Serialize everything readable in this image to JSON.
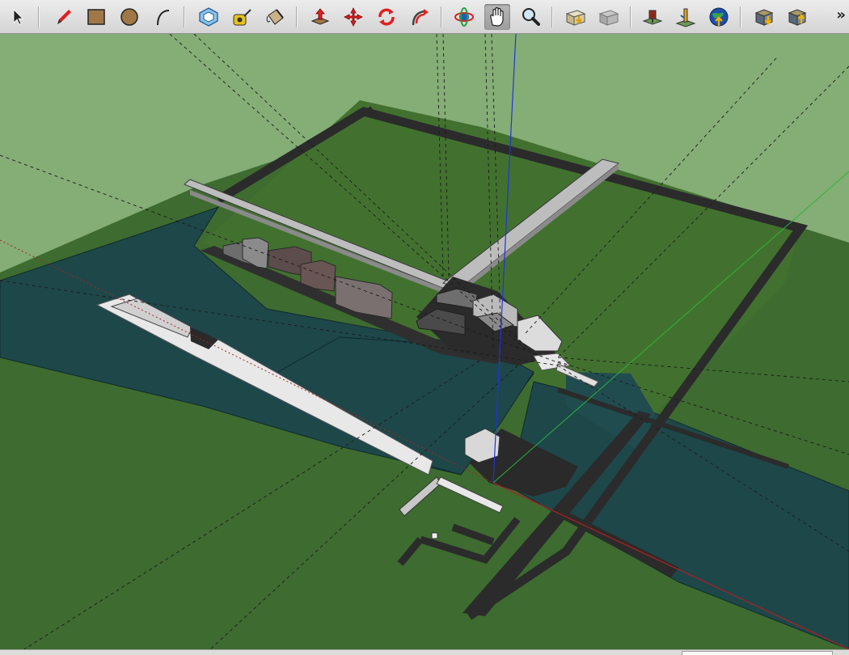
{
  "toolbar": {
    "overflow_label": "»",
    "tools": [
      {
        "name": "select-tool",
        "icon": "arrow-cursor-icon"
      },
      {
        "name": "line-tool",
        "icon": "pencil-icon"
      },
      {
        "name": "rectangle-tool",
        "icon": "rectangle-icon"
      },
      {
        "name": "circle-tool",
        "icon": "circle-icon"
      },
      {
        "name": "arc-tool",
        "icon": "arc-icon"
      },
      {
        "name": "make-component-tool",
        "icon": "component-icon"
      },
      {
        "name": "tape-measure-tool",
        "icon": "tape-measure-icon"
      },
      {
        "name": "paint-bucket-tool",
        "icon": "paint-bucket-icon"
      },
      {
        "name": "push-pull-tool",
        "icon": "push-pull-icon"
      },
      {
        "name": "move-tool",
        "icon": "move-icon"
      },
      {
        "name": "rotate-tool",
        "icon": "rotate-icon"
      },
      {
        "name": "follow-me-tool",
        "icon": "follow-me-icon"
      },
      {
        "name": "orbit-tool",
        "icon": "orbit-icon"
      },
      {
        "name": "pan-tool",
        "icon": "hand-icon",
        "active": true
      },
      {
        "name": "zoom-tool",
        "icon": "magnifier-icon"
      },
      {
        "name": "get-models-tool",
        "icon": "get-models-icon"
      },
      {
        "name": "share-model-tool",
        "icon": "share-model-icon"
      },
      {
        "name": "add-location-tool",
        "icon": "add-location-icon"
      },
      {
        "name": "toggle-terrain-tool",
        "icon": "toggle-terrain-icon"
      },
      {
        "name": "preview-in-google-earth-tool",
        "icon": "google-earth-icon"
      },
      {
        "name": "get-components-tool",
        "icon": "get-components-icon"
      },
      {
        "name": "share-component-tool",
        "icon": "share-component-icon"
      }
    ]
  },
  "viewport": {
    "sky_color": "#85ad76",
    "ground_color": "#3e6b30",
    "water_color": "#1e474a",
    "axis_colors": {
      "red": "#b02020",
      "green": "#2bb53a",
      "blue": "#2233dd"
    }
  }
}
